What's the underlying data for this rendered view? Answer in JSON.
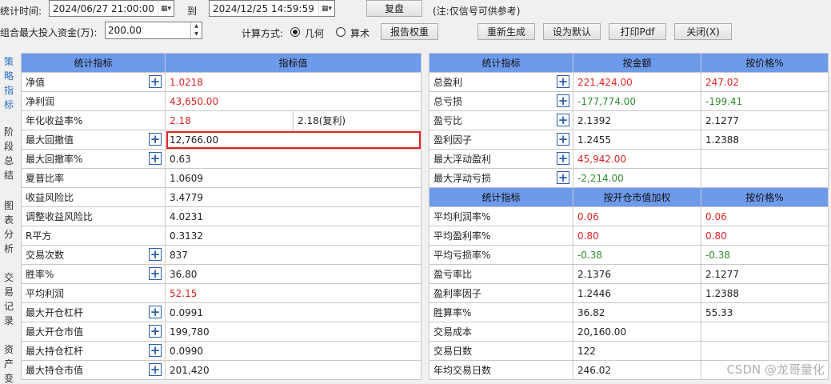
{
  "toolbar": {
    "period_label": "统计时间:",
    "start_date": "2024/06/27 21:00:00",
    "to_label": "到",
    "end_date": "2024/12/25 14:59:59",
    "review_button": "复盘",
    "note": "(注:仅信号可供参考)",
    "capital_label": "组合最大投入资金(万):",
    "capital_value": "200.00",
    "calc_method_label": "计算方式:",
    "geometric_label": "几何",
    "arithmetic_label": "算术",
    "report_weight_button": "报告权重",
    "regenerate_button": "重新生成",
    "set_default_button": "设为默认",
    "print_pdf_button": "打印Pdf",
    "close_button": "关闭(X)"
  },
  "vertical_tabs": [
    {
      "label": "策略指标",
      "active": true
    },
    {
      "label": "阶段总结",
      "active": false
    },
    {
      "label": "图表分析",
      "active": false
    },
    {
      "label": "交易记录",
      "active": false
    },
    {
      "label": "资产变",
      "active": false
    }
  ],
  "left_table": {
    "headers": [
      "统计指标",
      "指标值"
    ],
    "rows": [
      {
        "name": "净值",
        "plus": true,
        "value": "1.0218",
        "color": "red"
      },
      {
        "name": "净利润",
        "plus": false,
        "value": "43,650.00",
        "color": "red"
      },
      {
        "name": "年化收益率%",
        "plus": false,
        "value": "2.18",
        "color": "red",
        "extra": "2.18(复利)"
      },
      {
        "name": "最大回撤值",
        "plus": true,
        "value": "12,766.00",
        "color": "",
        "highlight": true
      },
      {
        "name": "最大回撤率%",
        "plus": true,
        "value": "0.63",
        "color": ""
      },
      {
        "name": "夏普比率",
        "plus": false,
        "value": "1.0609",
        "color": ""
      },
      {
        "name": "收益风险比",
        "plus": false,
        "value": "3.4779",
        "color": ""
      },
      {
        "name": "调整收益风险比",
        "plus": false,
        "value": "4.0231",
        "color": ""
      },
      {
        "name": "R平方",
        "plus": false,
        "value": "0.3132",
        "color": ""
      },
      {
        "name": "交易次数",
        "plus": true,
        "value": "837",
        "color": ""
      },
      {
        "name": "胜率%",
        "plus": true,
        "value": "36.80",
        "color": ""
      },
      {
        "name": "平均利润",
        "plus": false,
        "value": "52.15",
        "color": "red"
      },
      {
        "name": "最大开仓杠杆",
        "plus": true,
        "value": "0.0991",
        "color": ""
      },
      {
        "name": "最大开仓市值",
        "plus": true,
        "value": "199,780",
        "color": ""
      },
      {
        "name": "最大持仓杠杆",
        "plus": true,
        "value": "0.0990",
        "color": ""
      },
      {
        "name": "最大持仓市值",
        "plus": true,
        "value": "201,420",
        "color": ""
      }
    ]
  },
  "right_table_1": {
    "headers": [
      "统计指标",
      "按金额",
      "按价格%"
    ],
    "rows": [
      {
        "name": "总盈利",
        "plus": true,
        "v1": "221,424.00",
        "c1": "red",
        "v2": "247.02",
        "c2": "red"
      },
      {
        "name": "总亏损",
        "plus": true,
        "v1": "-177,774.00",
        "c1": "green",
        "v2": "-199.41",
        "c2": "green"
      },
      {
        "name": "盈亏比",
        "plus": true,
        "v1": "2.1392",
        "c1": "",
        "v2": "2.1277",
        "c2": ""
      },
      {
        "name": "盈利因子",
        "plus": true,
        "v1": "1.2455",
        "c1": "",
        "v2": "1.2388",
        "c2": ""
      },
      {
        "name": "最大浮动盈利",
        "plus": true,
        "v1": "45,942.00",
        "c1": "red",
        "v2": "",
        "c2": ""
      },
      {
        "name": "最大浮动亏损",
        "plus": true,
        "v1": "-2,214.00",
        "c1": "green",
        "v2": "",
        "c2": ""
      }
    ]
  },
  "right_table_2": {
    "headers": [
      "统计指标",
      "按开仓市值加权",
      "按价格%"
    ],
    "rows": [
      {
        "name": "平均利润率%",
        "v1": "0.06",
        "c1": "red",
        "v2": "0.06",
        "c2": "red"
      },
      {
        "name": "平均盈利率%",
        "v1": "0.80",
        "c1": "red",
        "v2": "0.80",
        "c2": "red"
      },
      {
        "name": "平均亏损率%",
        "v1": "-0.38",
        "c1": "green",
        "v2": "-0.38",
        "c2": "green"
      },
      {
        "name": "盈亏率比",
        "v1": "2.1376",
        "c1": "",
        "v2": "2.1277",
        "c2": ""
      },
      {
        "name": "盈利率因子",
        "v1": "1.2446",
        "c1": "",
        "v2": "1.2388",
        "c2": ""
      },
      {
        "name": "胜算率%",
        "v1": "36.82",
        "c1": "",
        "v2": "55.33",
        "c2": ""
      },
      {
        "name": "交易成本",
        "v1": "20,160.00",
        "c1": "",
        "v2": "",
        "c2": ""
      },
      {
        "name": "交易日数",
        "v1": "122",
        "c1": "",
        "v2": "",
        "c2": ""
      },
      {
        "name": "年均交易日数",
        "v1": "246.02",
        "c1": "",
        "v2": "",
        "c2": ""
      }
    ]
  },
  "watermark": "CSDN @龙哥量化",
  "colors": {
    "header_bg": "#6d9aea",
    "positive": "#e02424",
    "negative": "#2e8b2e",
    "active_tab": "#2c6cc2"
  }
}
